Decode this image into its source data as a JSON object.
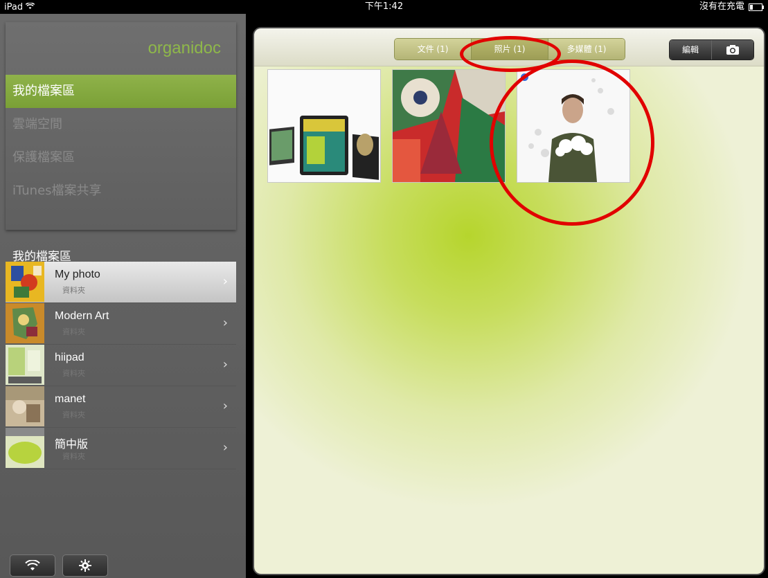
{
  "status_bar": {
    "device": "iPad",
    "time": "下午1:42",
    "battery_text": "沒有在充電"
  },
  "sidebar": {
    "logo": "organidoc",
    "nav": [
      {
        "label": "我的檔案區",
        "active": true
      },
      {
        "label": "雲端空間",
        "active": false
      },
      {
        "label": "保護檔案區",
        "active": false
      },
      {
        "label": "iTunes檔案共享",
        "active": false
      }
    ],
    "section_title": "我的檔案區",
    "folders": [
      {
        "name": "My photo",
        "sub": "資料夾",
        "selected": true
      },
      {
        "name": "Modern Art",
        "sub": "資料夾",
        "selected": false
      },
      {
        "name": "hiipad",
        "sub": "資料夾",
        "selected": false
      },
      {
        "name": "manet",
        "sub": "資料夾",
        "selected": false
      },
      {
        "name": "簡中版",
        "sub": "資料夾",
        "selected": false
      }
    ],
    "bottom_buttons": [
      {
        "icon": "wifi-icon"
      },
      {
        "icon": "gear-icon"
      }
    ]
  },
  "toolbar": {
    "tabs": [
      {
        "label": "文件 (1)",
        "active": false
      },
      {
        "label": "照片 (1)",
        "active": true
      },
      {
        "label": "多媒體 (1)",
        "active": false
      }
    ],
    "edit_label": "編輯",
    "camera_icon": "camera-icon"
  },
  "photos": [
    {
      "name": "ipad-magazine-photo"
    },
    {
      "name": "painting-photo"
    },
    {
      "name": "person-photo",
      "selected": true
    }
  ],
  "colors": {
    "accent_green": "#8fb24a",
    "annotation_red": "#e10000"
  }
}
